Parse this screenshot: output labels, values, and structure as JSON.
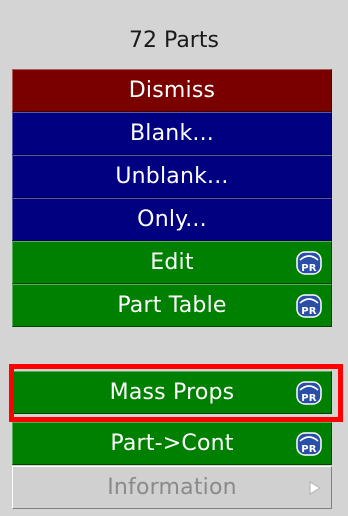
{
  "panel": {
    "title": "72 Parts"
  },
  "buttons": {
    "dismiss": "Dismiss",
    "blank": "Blank...",
    "unblank": "Unblank...",
    "only": "Only...",
    "edit": "Edit",
    "part_table": "Part Table",
    "mass_props": "Mass Props",
    "part_cont": "Part->Cont",
    "information": "Information"
  },
  "icons": {
    "primer_badge": "pr-icon",
    "submenu": "submenu-arrow-icon"
  },
  "colors": {
    "dismiss_bg": "#7a0000",
    "blue_bg": "#000080",
    "green_bg": "#008000",
    "highlight": "#ff0000",
    "disabled_bg": "#d0d0d0"
  },
  "highlighted_button": "Mass Props"
}
